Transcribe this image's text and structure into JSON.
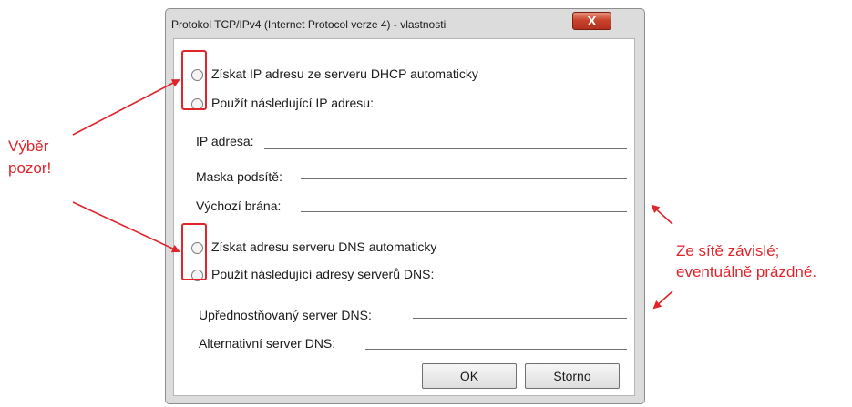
{
  "dialog": {
    "title": "Protokol TCP/IPv4 (Internet Protocol verze 4) - vlastnosti",
    "close_label": "X"
  },
  "ip_section": {
    "option_auto": "Získat IP adresu ze serveru DHCP automaticky",
    "option_manual": "Použít následující IP adresu:",
    "ip_address_label": "IP adresa:",
    "subnet_mask_label": "Maska podsítě:",
    "default_gateway_label": "Výchozí brána:"
  },
  "dns_section": {
    "option_auto": "Získat adresu serveru DNS automaticky",
    "option_manual": "Použít následující adresy serverů DNS:",
    "preferred_dns_label": "Upřednostňovaný server DNS:",
    "alternate_dns_label": "Alternativní server DNS:"
  },
  "buttons": {
    "ok": "OK",
    "cancel": "Storno"
  },
  "annotations": {
    "left_line1": "Výběr",
    "left_line2": "pozor!",
    "right_line1": "Ze sítě závislé;",
    "right_line2": "eventuálně prázdné."
  },
  "colors": {
    "annotation": "#e0242a",
    "close_button": "#c9442c"
  }
}
